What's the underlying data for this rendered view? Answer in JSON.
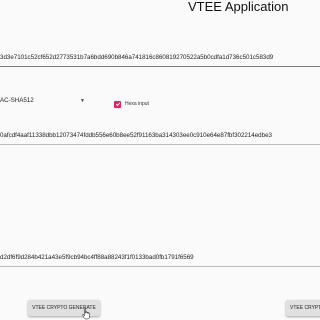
{
  "app": {
    "title": "VTEE Application"
  },
  "fields": {
    "input_value": "3d3e7101c52cf652d2773531b7a6bdd690b846a741816c860819270522a5b0cdfa1d736c501c583d9",
    "key_value": "0afcdf4aaf11338dbb12073474fddb556e60b8ee52f91163ba314303ee0c910e64e87fbf302214edbe3",
    "output_value": "d2df6f9d284b421a43e5f9cb94bc4ff88a88243f1f0133bad0fb1791f6569"
  },
  "algorithm": {
    "selected": "AC-SHA512"
  },
  "hexa_input": {
    "label": "Hexa input",
    "checked": true
  },
  "buttons": {
    "generate_label": "VTEE CRYPTO GENERATE",
    "second_label": "VTEE CRYPTO"
  },
  "colors": {
    "accent": "#e91e63",
    "button_bg": "#e0e0e0"
  }
}
